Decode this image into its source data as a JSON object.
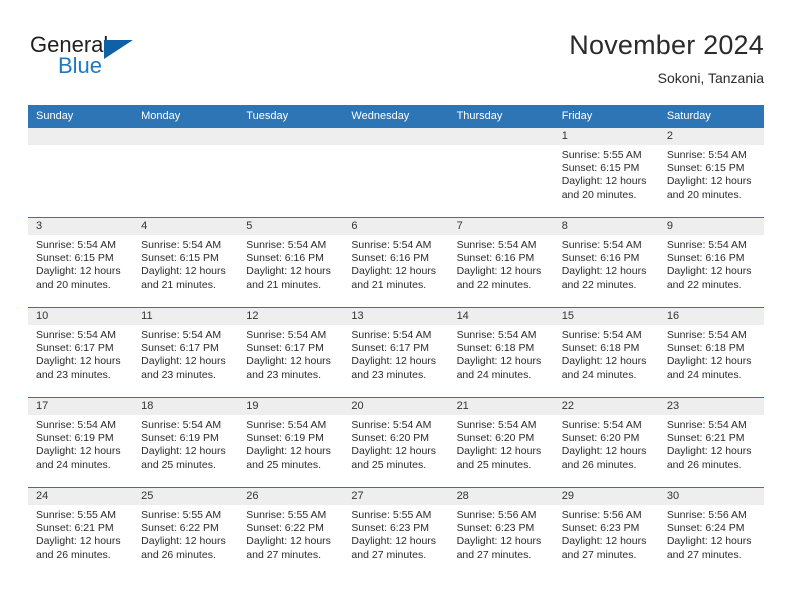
{
  "logo": {
    "text_general": "General",
    "text_blue": "Blue",
    "icon": "triangle-logo-icon",
    "color_blue": "#1f78c1",
    "color_triangle": "#1060a8",
    "color_dark": "#231f20"
  },
  "header": {
    "title": "November 2024",
    "subtitle": "Sokoni, Tanzania"
  },
  "theme": {
    "header_row_bg": "#2e75b6",
    "header_row_text": "#ffffff",
    "daynum_band_bg": "#eeeeee",
    "cell_text": "#2b2b2b",
    "grid_line": "#2e75b6"
  },
  "weekday_headers": [
    "Sunday",
    "Monday",
    "Tuesday",
    "Wednesday",
    "Thursday",
    "Friday",
    "Saturday"
  ],
  "weeks": [
    [
      {
        "day": "",
        "empty": true,
        "lines": []
      },
      {
        "day": "",
        "empty": true,
        "lines": []
      },
      {
        "day": "",
        "empty": true,
        "lines": []
      },
      {
        "day": "",
        "empty": true,
        "lines": []
      },
      {
        "day": "",
        "empty": true,
        "lines": []
      },
      {
        "day": "1",
        "empty": false,
        "lines": [
          "Sunrise: 5:55 AM",
          "Sunset: 6:15 PM",
          "Daylight: 12 hours",
          "and 20 minutes."
        ]
      },
      {
        "day": "2",
        "empty": false,
        "lines": [
          "Sunrise: 5:54 AM",
          "Sunset: 6:15 PM",
          "Daylight: 12 hours",
          "and 20 minutes."
        ]
      }
    ],
    [
      {
        "day": "3",
        "empty": false,
        "lines": [
          "Sunrise: 5:54 AM",
          "Sunset: 6:15 PM",
          "Daylight: 12 hours",
          "and 20 minutes."
        ]
      },
      {
        "day": "4",
        "empty": false,
        "lines": [
          "Sunrise: 5:54 AM",
          "Sunset: 6:15 PM",
          "Daylight: 12 hours",
          "and 21 minutes."
        ]
      },
      {
        "day": "5",
        "empty": false,
        "lines": [
          "Sunrise: 5:54 AM",
          "Sunset: 6:16 PM",
          "Daylight: 12 hours",
          "and 21 minutes."
        ]
      },
      {
        "day": "6",
        "empty": false,
        "lines": [
          "Sunrise: 5:54 AM",
          "Sunset: 6:16 PM",
          "Daylight: 12 hours",
          "and 21 minutes."
        ]
      },
      {
        "day": "7",
        "empty": false,
        "lines": [
          "Sunrise: 5:54 AM",
          "Sunset: 6:16 PM",
          "Daylight: 12 hours",
          "and 22 minutes."
        ]
      },
      {
        "day": "8",
        "empty": false,
        "lines": [
          "Sunrise: 5:54 AM",
          "Sunset: 6:16 PM",
          "Daylight: 12 hours",
          "and 22 minutes."
        ]
      },
      {
        "day": "9",
        "empty": false,
        "lines": [
          "Sunrise: 5:54 AM",
          "Sunset: 6:16 PM",
          "Daylight: 12 hours",
          "and 22 minutes."
        ]
      }
    ],
    [
      {
        "day": "10",
        "empty": false,
        "lines": [
          "Sunrise: 5:54 AM",
          "Sunset: 6:17 PM",
          "Daylight: 12 hours",
          "and 23 minutes."
        ]
      },
      {
        "day": "11",
        "empty": false,
        "lines": [
          "Sunrise: 5:54 AM",
          "Sunset: 6:17 PM",
          "Daylight: 12 hours",
          "and 23 minutes."
        ]
      },
      {
        "day": "12",
        "empty": false,
        "lines": [
          "Sunrise: 5:54 AM",
          "Sunset: 6:17 PM",
          "Daylight: 12 hours",
          "and 23 minutes."
        ]
      },
      {
        "day": "13",
        "empty": false,
        "lines": [
          "Sunrise: 5:54 AM",
          "Sunset: 6:17 PM",
          "Daylight: 12 hours",
          "and 23 minutes."
        ]
      },
      {
        "day": "14",
        "empty": false,
        "lines": [
          "Sunrise: 5:54 AM",
          "Sunset: 6:18 PM",
          "Daylight: 12 hours",
          "and 24 minutes."
        ]
      },
      {
        "day": "15",
        "empty": false,
        "lines": [
          "Sunrise: 5:54 AM",
          "Sunset: 6:18 PM",
          "Daylight: 12 hours",
          "and 24 minutes."
        ]
      },
      {
        "day": "16",
        "empty": false,
        "lines": [
          "Sunrise: 5:54 AM",
          "Sunset: 6:18 PM",
          "Daylight: 12 hours",
          "and 24 minutes."
        ]
      }
    ],
    [
      {
        "day": "17",
        "empty": false,
        "lines": [
          "Sunrise: 5:54 AM",
          "Sunset: 6:19 PM",
          "Daylight: 12 hours",
          "and 24 minutes."
        ]
      },
      {
        "day": "18",
        "empty": false,
        "lines": [
          "Sunrise: 5:54 AM",
          "Sunset: 6:19 PM",
          "Daylight: 12 hours",
          "and 25 minutes."
        ]
      },
      {
        "day": "19",
        "empty": false,
        "lines": [
          "Sunrise: 5:54 AM",
          "Sunset: 6:19 PM",
          "Daylight: 12 hours",
          "and 25 minutes."
        ]
      },
      {
        "day": "20",
        "empty": false,
        "lines": [
          "Sunrise: 5:54 AM",
          "Sunset: 6:20 PM",
          "Daylight: 12 hours",
          "and 25 minutes."
        ]
      },
      {
        "day": "21",
        "empty": false,
        "lines": [
          "Sunrise: 5:54 AM",
          "Sunset: 6:20 PM",
          "Daylight: 12 hours",
          "and 25 minutes."
        ]
      },
      {
        "day": "22",
        "empty": false,
        "lines": [
          "Sunrise: 5:54 AM",
          "Sunset: 6:20 PM",
          "Daylight: 12 hours",
          "and 26 minutes."
        ]
      },
      {
        "day": "23",
        "empty": false,
        "lines": [
          "Sunrise: 5:54 AM",
          "Sunset: 6:21 PM",
          "Daylight: 12 hours",
          "and 26 minutes."
        ]
      }
    ],
    [
      {
        "day": "24",
        "empty": false,
        "lines": [
          "Sunrise: 5:55 AM",
          "Sunset: 6:21 PM",
          "Daylight: 12 hours",
          "and 26 minutes."
        ]
      },
      {
        "day": "25",
        "empty": false,
        "lines": [
          "Sunrise: 5:55 AM",
          "Sunset: 6:22 PM",
          "Daylight: 12 hours",
          "and 26 minutes."
        ]
      },
      {
        "day": "26",
        "empty": false,
        "lines": [
          "Sunrise: 5:55 AM",
          "Sunset: 6:22 PM",
          "Daylight: 12 hours",
          "and 27 minutes."
        ]
      },
      {
        "day": "27",
        "empty": false,
        "lines": [
          "Sunrise: 5:55 AM",
          "Sunset: 6:23 PM",
          "Daylight: 12 hours",
          "and 27 minutes."
        ]
      },
      {
        "day": "28",
        "empty": false,
        "lines": [
          "Sunrise: 5:56 AM",
          "Sunset: 6:23 PM",
          "Daylight: 12 hours",
          "and 27 minutes."
        ]
      },
      {
        "day": "29",
        "empty": false,
        "lines": [
          "Sunrise: 5:56 AM",
          "Sunset: 6:23 PM",
          "Daylight: 12 hours",
          "and 27 minutes."
        ]
      },
      {
        "day": "30",
        "empty": false,
        "lines": [
          "Sunrise: 5:56 AM",
          "Sunset: 6:24 PM",
          "Daylight: 12 hours",
          "and 27 minutes."
        ]
      }
    ]
  ]
}
